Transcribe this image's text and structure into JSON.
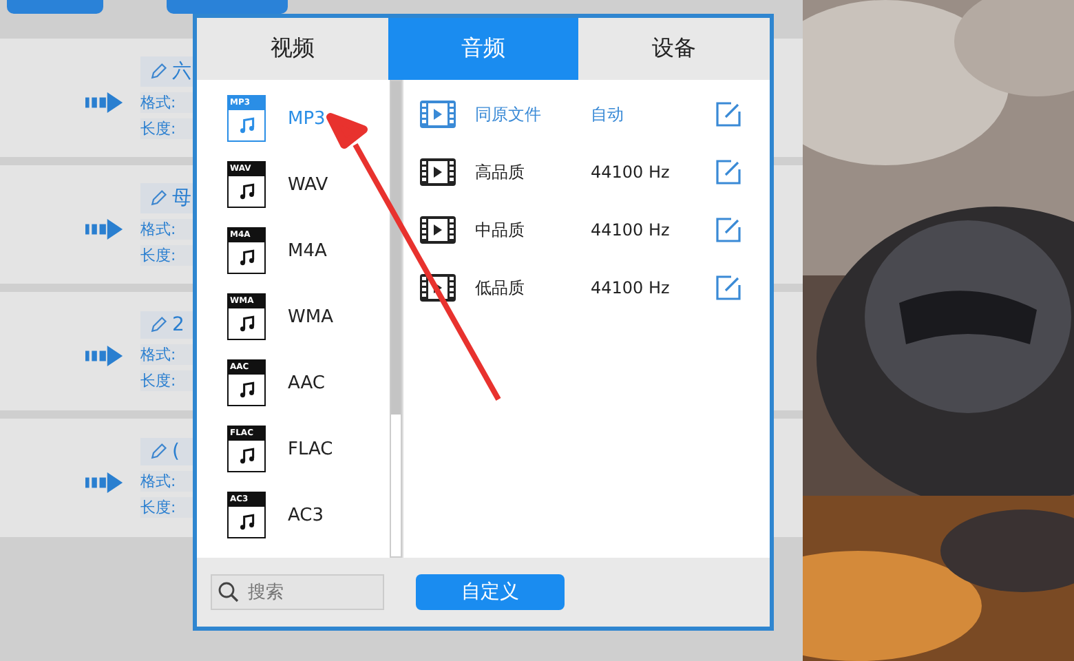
{
  "background_list": [
    {
      "title": "六",
      "format_label": "格式:",
      "length_label": "长度:"
    },
    {
      "title": "母",
      "format_label": "格式:",
      "length_label": "长度:"
    },
    {
      "title": "2",
      "format_label": "格式:",
      "length_label": "长度:"
    },
    {
      "title": "(",
      "format_label": "格式:",
      "length_label": "长度:"
    }
  ],
  "dialog": {
    "tabs": [
      {
        "label": "视频",
        "selected": false
      },
      {
        "label": "音频",
        "selected": true
      },
      {
        "label": "设备",
        "selected": false
      }
    ],
    "formats": [
      {
        "name": "MP3",
        "tag": "MP3",
        "selected": true
      },
      {
        "name": "WAV",
        "tag": "WAV",
        "selected": false
      },
      {
        "name": "M4A",
        "tag": "M4A",
        "selected": false
      },
      {
        "name": "WMA",
        "tag": "WMA",
        "selected": false
      },
      {
        "name": "AAC",
        "tag": "AAC",
        "selected": false
      },
      {
        "name": "FLAC",
        "tag": "FLAC",
        "selected": false
      },
      {
        "name": "AC3",
        "tag": "AC3",
        "selected": false
      }
    ],
    "presets": [
      {
        "name": "同原文件",
        "rate": "自动",
        "selected": true
      },
      {
        "name": "高品质",
        "rate": "44100 Hz",
        "selected": false
      },
      {
        "name": "中品质",
        "rate": "44100 Hz",
        "selected": false
      },
      {
        "name": "低品质",
        "rate": "44100 Hz",
        "selected": false
      }
    ],
    "search": {
      "placeholder": "搜索"
    },
    "custom_button": "自定义"
  }
}
